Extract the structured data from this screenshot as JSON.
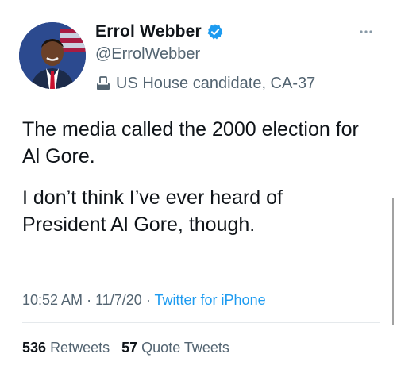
{
  "tweet": {
    "author": {
      "display_name": "Errol Webber",
      "handle": "@ErrolWebber",
      "label": "US House candidate, CA-37",
      "verified": true
    },
    "body": [
      "The media called the 2000 election for Al Gore.",
      "I don’t think I’ve ever heard of President Al Gore, though."
    ],
    "meta": {
      "time": "10:52 AM",
      "separator": "·",
      "date": "11/7/20",
      "source": "Twitter for iPhone"
    },
    "stats": {
      "retweets_count": "536",
      "retweets_label": "Retweets",
      "quotes_count": "57",
      "quotes_label": "Quote Tweets"
    }
  },
  "icons": {
    "verified": "verified-badge-icon",
    "label": "ballot-box-icon",
    "more": "more-dots-icon"
  },
  "colors": {
    "text": "#0f1419",
    "secondary": "#536471",
    "accent": "#1d9bf0"
  }
}
